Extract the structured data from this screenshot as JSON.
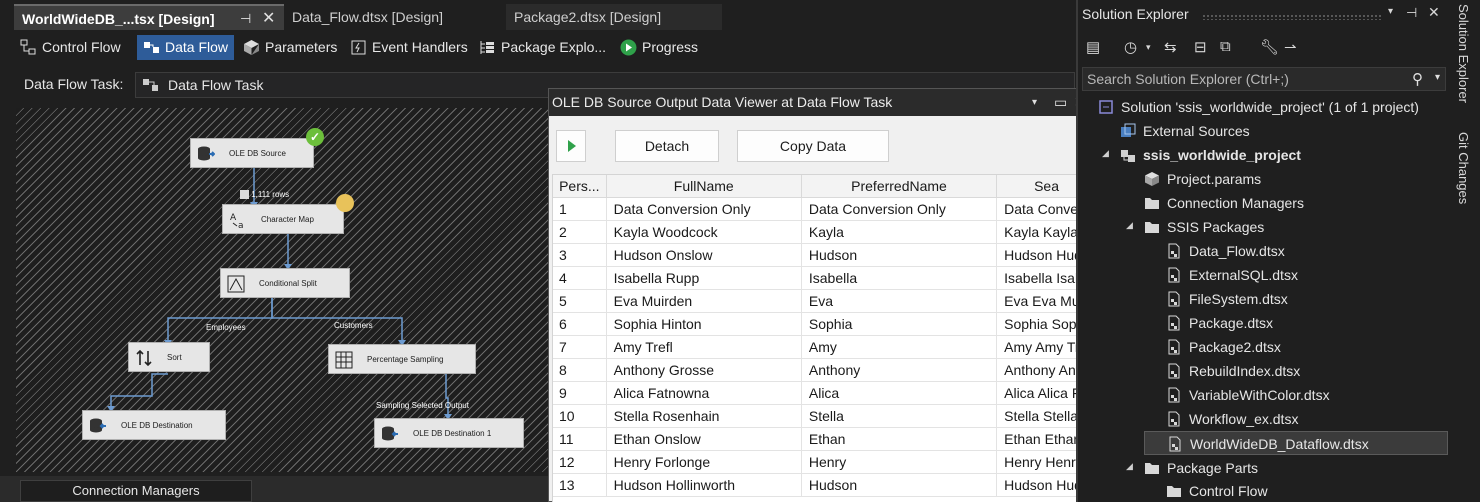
{
  "doc_tabs": [
    {
      "label": "WorldWideDB_...tsx [Design]",
      "active": true
    },
    {
      "label": "Data_Flow.dtsx [Design]",
      "active": false
    },
    {
      "label": "Package2.dtsx [Design]",
      "active": false
    }
  ],
  "design_tabs": {
    "control_flow": "Control Flow",
    "data_flow": "Data Flow",
    "parameters": "Parameters",
    "event_handlers": "Event Handlers",
    "package_explorer": "Package Explo...",
    "progress": "Progress"
  },
  "data_flow_task": {
    "label": "Data Flow Task:",
    "value": "Data Flow Task"
  },
  "canvas": {
    "components": {
      "ole_db_source": "OLE DB Source",
      "character_map": "Character Map",
      "conditional_split": "Conditional Split",
      "sort": "Sort",
      "percentage_sampling": "Percentage Sampling",
      "ole_db_destination": "OLE DB Destination",
      "ole_db_destination_1": "OLE DB Destination 1"
    },
    "flow_labels": {
      "rows": "1,111 rows",
      "employees": "Employees",
      "customers": "Customers",
      "sampling_output": "Sampling Selected Output"
    }
  },
  "connection_managers_tab": "Connection Managers",
  "viewer": {
    "title": "OLE DB Source Output Data Viewer at Data Flow Task",
    "detach": "Detach",
    "copy_data": "Copy Data",
    "columns": [
      "Pers...",
      "FullName",
      "PreferredName",
      "Sea"
    ],
    "rows": [
      [
        "1",
        "Data Conversion Only",
        "Data Conversion Only",
        "Data Conver"
      ],
      [
        "2",
        "Kayla Woodcock",
        "Kayla",
        "Kayla Kayla W"
      ],
      [
        "3",
        "Hudson Onslow",
        "Hudson",
        "Hudson Hud"
      ],
      [
        "4",
        "Isabella Rupp",
        "Isabella",
        "Isabella Isabe"
      ],
      [
        "5",
        "Eva Muirden",
        "Eva",
        "Eva Eva Mui"
      ],
      [
        "6",
        "Sophia Hinton",
        "Sophia",
        "Sophia Soph"
      ],
      [
        "7",
        "Amy Trefl",
        "Amy",
        "Amy Amy Tr"
      ],
      [
        "8",
        "Anthony Grosse",
        "Anthony",
        "Anthony Ant"
      ],
      [
        "9",
        "Alica Fatnowna",
        "Alica",
        "Alica Alica Fa"
      ],
      [
        "10",
        "Stella Rosenhain",
        "Stella",
        "Stella Stella R"
      ],
      [
        "11",
        "Ethan Onslow",
        "Ethan",
        "Ethan Ethan"
      ],
      [
        "12",
        "Henry Forlonge",
        "Henry",
        "Henry Henry"
      ],
      [
        "13",
        "Hudson Hollinworth",
        "Hudson",
        "Hudson Hud"
      ]
    ]
  },
  "solution_explorer": {
    "title": "Solution Explorer",
    "search_placeholder": "Search Solution Explorer (Ctrl+;)",
    "tree": {
      "solution": "Solution 'ssis_worldwide_project' (1 of 1 project)",
      "external_sources": "External Sources",
      "project": "ssis_worldwide_project",
      "project_params": "Project.params",
      "connection_managers": "Connection Managers",
      "ssis_packages": "SSIS Packages",
      "packages": [
        "Data_Flow.dtsx",
        "ExternalSQL.dtsx",
        "FileSystem.dtsx",
        "Package.dtsx",
        "Package2.dtsx",
        "RebuildIndex.dtsx",
        "VariableWithColor.dtsx",
        "Workflow_ex.dtsx",
        "WorldWideDB_Dataflow.dtsx"
      ],
      "package_parts": "Package Parts",
      "control_flow": "Control Flow"
    }
  },
  "side_tabs": {
    "solution_explorer": "Solution Explorer",
    "git_changes": "Git Changes"
  },
  "colors": {
    "accent": "#2e5c99",
    "ok_badge": "#6cbf3b",
    "flow_line": "#6d9bd1"
  }
}
